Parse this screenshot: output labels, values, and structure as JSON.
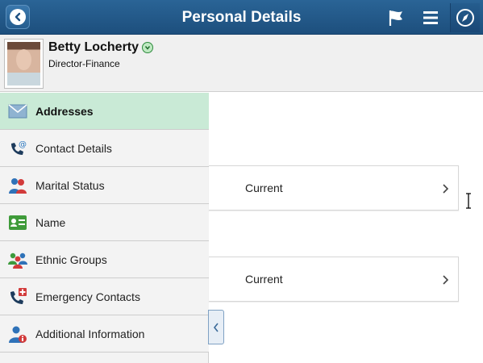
{
  "header": {
    "title": "Personal Details",
    "back_icon": "back-chevron-icon",
    "flag_icon": "flag-icon",
    "menu_icon": "hamburger-menu-icon",
    "nav_icon": "compass-navbar-icon",
    "bg_color": "#1f5183"
  },
  "profile": {
    "name": "Betty Locherty",
    "title": "Director-Finance",
    "status_icon": "related-actions-chevron-icon"
  },
  "sidenav": {
    "active_color": "#c9ead6",
    "items": [
      {
        "label": "Addresses",
        "icon": "envelope-icon",
        "active": true
      },
      {
        "label": "Contact Details",
        "icon": "phone-at-icon",
        "active": false
      },
      {
        "label": "Marital Status",
        "icon": "couple-icon",
        "active": false
      },
      {
        "label": "Name",
        "icon": "name-card-icon",
        "active": false
      },
      {
        "label": "Ethnic Groups",
        "icon": "group-people-icon",
        "active": false
      },
      {
        "label": "Emergency Contacts",
        "icon": "emergency-phone-icon",
        "active": false
      },
      {
        "label": "Additional Information",
        "icon": "person-info-icon",
        "active": false
      }
    ]
  },
  "content": {
    "rows": [
      {
        "label": "Current"
      },
      {
        "label": "Current"
      }
    ]
  }
}
